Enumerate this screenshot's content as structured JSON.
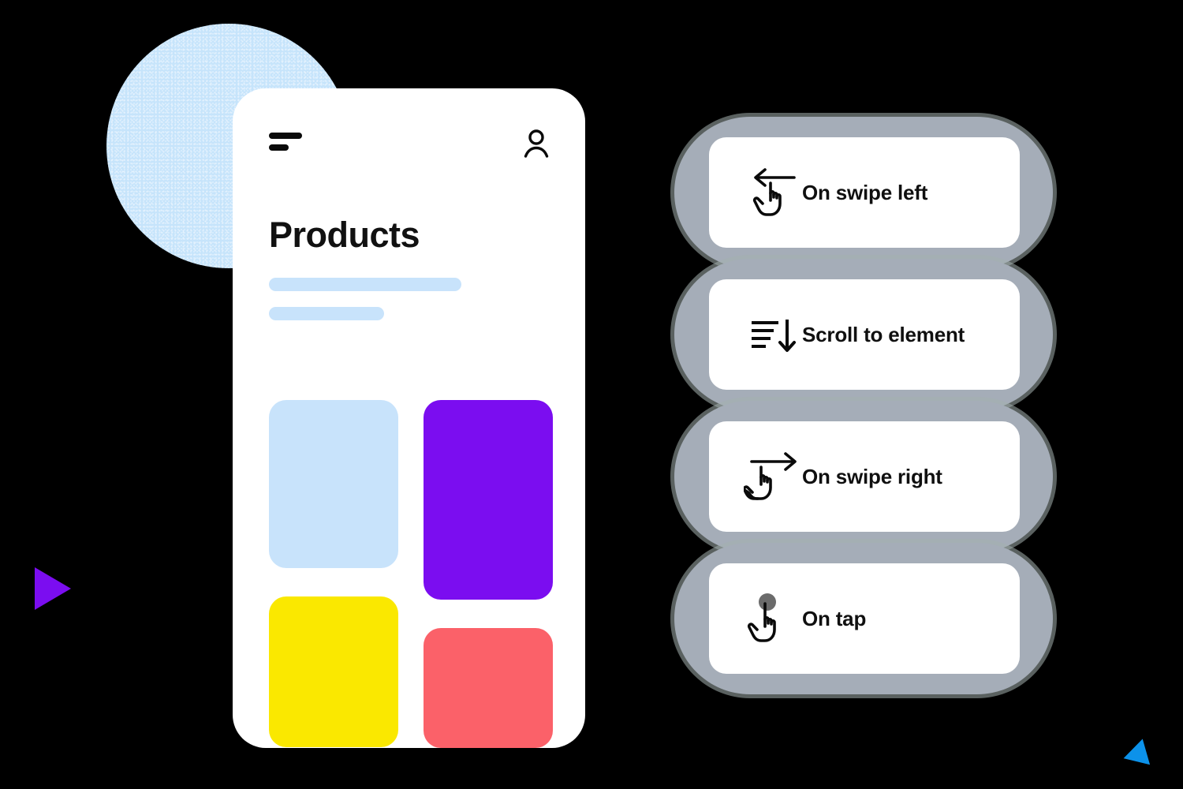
{
  "background_color": "#000000",
  "decorations": {
    "circle": {
      "name": "blue-grain-circle",
      "color": "#C6E4FB"
    },
    "triangle_purple": {
      "name": "purple-play-triangle",
      "color": "#7B0DF0"
    },
    "triangle_blue": {
      "name": "blue-play-triangle",
      "color": "#0C92EA"
    }
  },
  "phone": {
    "title": "Products",
    "menu_icon": "hamburger-menu-icon",
    "account_icon": "user-account-icon",
    "skeleton_lines": 2,
    "skeleton_color": "#C8E3FB",
    "background_color": "#FFFFFF",
    "tiles": [
      {
        "name": "product-tile-blue",
        "color": "#C8E3FB"
      },
      {
        "name": "product-tile-purple",
        "color": "#7B0DF0"
      },
      {
        "name": "product-tile-yellow",
        "color": "#FAE800"
      },
      {
        "name": "product-tile-coral",
        "color": "#FB6169"
      }
    ]
  },
  "actions": {
    "container_color": "#A5ADB8",
    "card_color": "#FFFFFF",
    "items": [
      {
        "label": "On swipe left",
        "icon": "swipe-left-hand-icon"
      },
      {
        "label": "Scroll to element",
        "icon": "scroll-down-lines-icon"
      },
      {
        "label": "On swipe right",
        "icon": "swipe-right-hand-icon"
      },
      {
        "label": "On tap",
        "icon": "tap-hand-icon"
      }
    ]
  }
}
